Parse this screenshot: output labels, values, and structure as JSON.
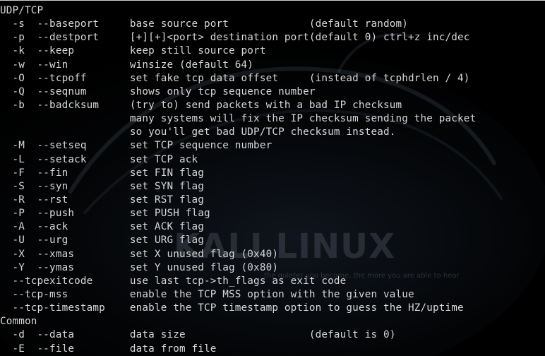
{
  "terminal": {
    "watermark": {
      "title": "KALI LINUX",
      "tagline": "the quieter you become, the more you are able to hear"
    },
    "lines": [
      {
        "text": "UDP/TCP"
      },
      {
        "text": "  -s  --baseport     base source port             (default random)"
      },
      {
        "text": "  -p  --destport     [+][+]<port> destination port(default 0) ctrl+z inc/dec"
      },
      {
        "text": "  -k  --keep         keep still source port"
      },
      {
        "text": "  -w  --win          winsize (default 64)"
      },
      {
        "text": "  -O  --tcpoff       set fake tcp data offset     (instead of tcphdrlen / 4)"
      },
      {
        "text": "  -Q  --seqnum       shows only tcp sequence number"
      },
      {
        "text": "  -b  --badcksum     (try to) send packets with a bad IP checksum"
      },
      {
        "text": "                     many systems will fix the IP checksum sending the packet"
      },
      {
        "text": "                     so you'll get bad UDP/TCP checksum instead."
      },
      {
        "text": "  -M  --setseq       set TCP sequence number"
      },
      {
        "text": "  -L  --setack       set TCP ack"
      },
      {
        "text": "  -F  --fin          set FIN flag"
      },
      {
        "text": "  -S  --syn          set SYN flag"
      },
      {
        "text": "  -R  --rst          set RST flag"
      },
      {
        "text": "  -P  --push         set PUSH flag"
      },
      {
        "text": "  -A  --ack          set ACK flag"
      },
      {
        "text": "  -U  --urg          set URG flag"
      },
      {
        "text": "  -X  --xmas         set X unused flag (0x40)"
      },
      {
        "text": "  -Y  --ymas         set Y unused flag (0x80)"
      },
      {
        "text": "  --tcpexitcode      use last tcp->th_flags as exit code"
      },
      {
        "text": "  --tcp-mss          enable the TCP MSS option with the given value"
      },
      {
        "text": "  --tcp-timestamp    enable the TCP timestamp option to guess the HZ/uptime"
      },
      {
        "text": "Common"
      },
      {
        "text": "  -d  --data         data size                    (default is 0)"
      },
      {
        "text": "  -E  --file         data from file"
      }
    ]
  }
}
